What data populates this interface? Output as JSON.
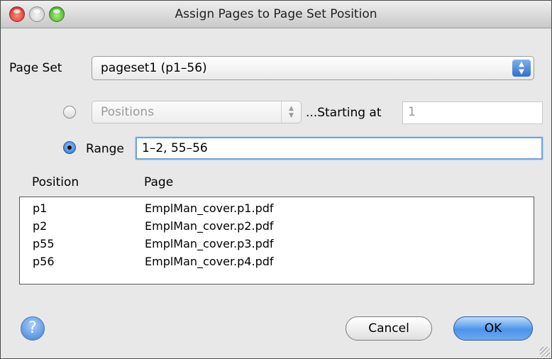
{
  "window": {
    "title": "Assign Pages to Page Set Position"
  },
  "form": {
    "page_set_label": "Page Set",
    "page_set_value": "pageset1 (p1–56)",
    "positions_radio_selected": false,
    "positions_select_value": "Positions",
    "starting_at_label": "...Starting at",
    "starting_at_value": "1",
    "range_radio_selected": true,
    "range_label": "Range",
    "range_value": "1–2, 55–56"
  },
  "table": {
    "headers": {
      "position": "Position",
      "page": "Page"
    },
    "rows": [
      {
        "position": "p1",
        "page": "EmplMan_cover.p1.pdf"
      },
      {
        "position": "p2",
        "page": "EmplMan_cover.p2.pdf"
      },
      {
        "position": "p55",
        "page": "EmplMan_cover.p3.pdf"
      },
      {
        "position": "p56",
        "page": "EmplMan_cover.p4.pdf"
      }
    ]
  },
  "buttons": {
    "help_glyph": "?",
    "cancel_label": "Cancel",
    "ok_label": "OK"
  },
  "icons": {
    "close": "close-icon",
    "minimize": "minimize-icon",
    "zoom": "zoom-icon",
    "help": "help-icon",
    "resize": "resize-grip-icon"
  },
  "colors": {
    "accent": "#2d6fd1",
    "close_button": "#c8201a",
    "zoom_button": "#2f9c1a"
  }
}
